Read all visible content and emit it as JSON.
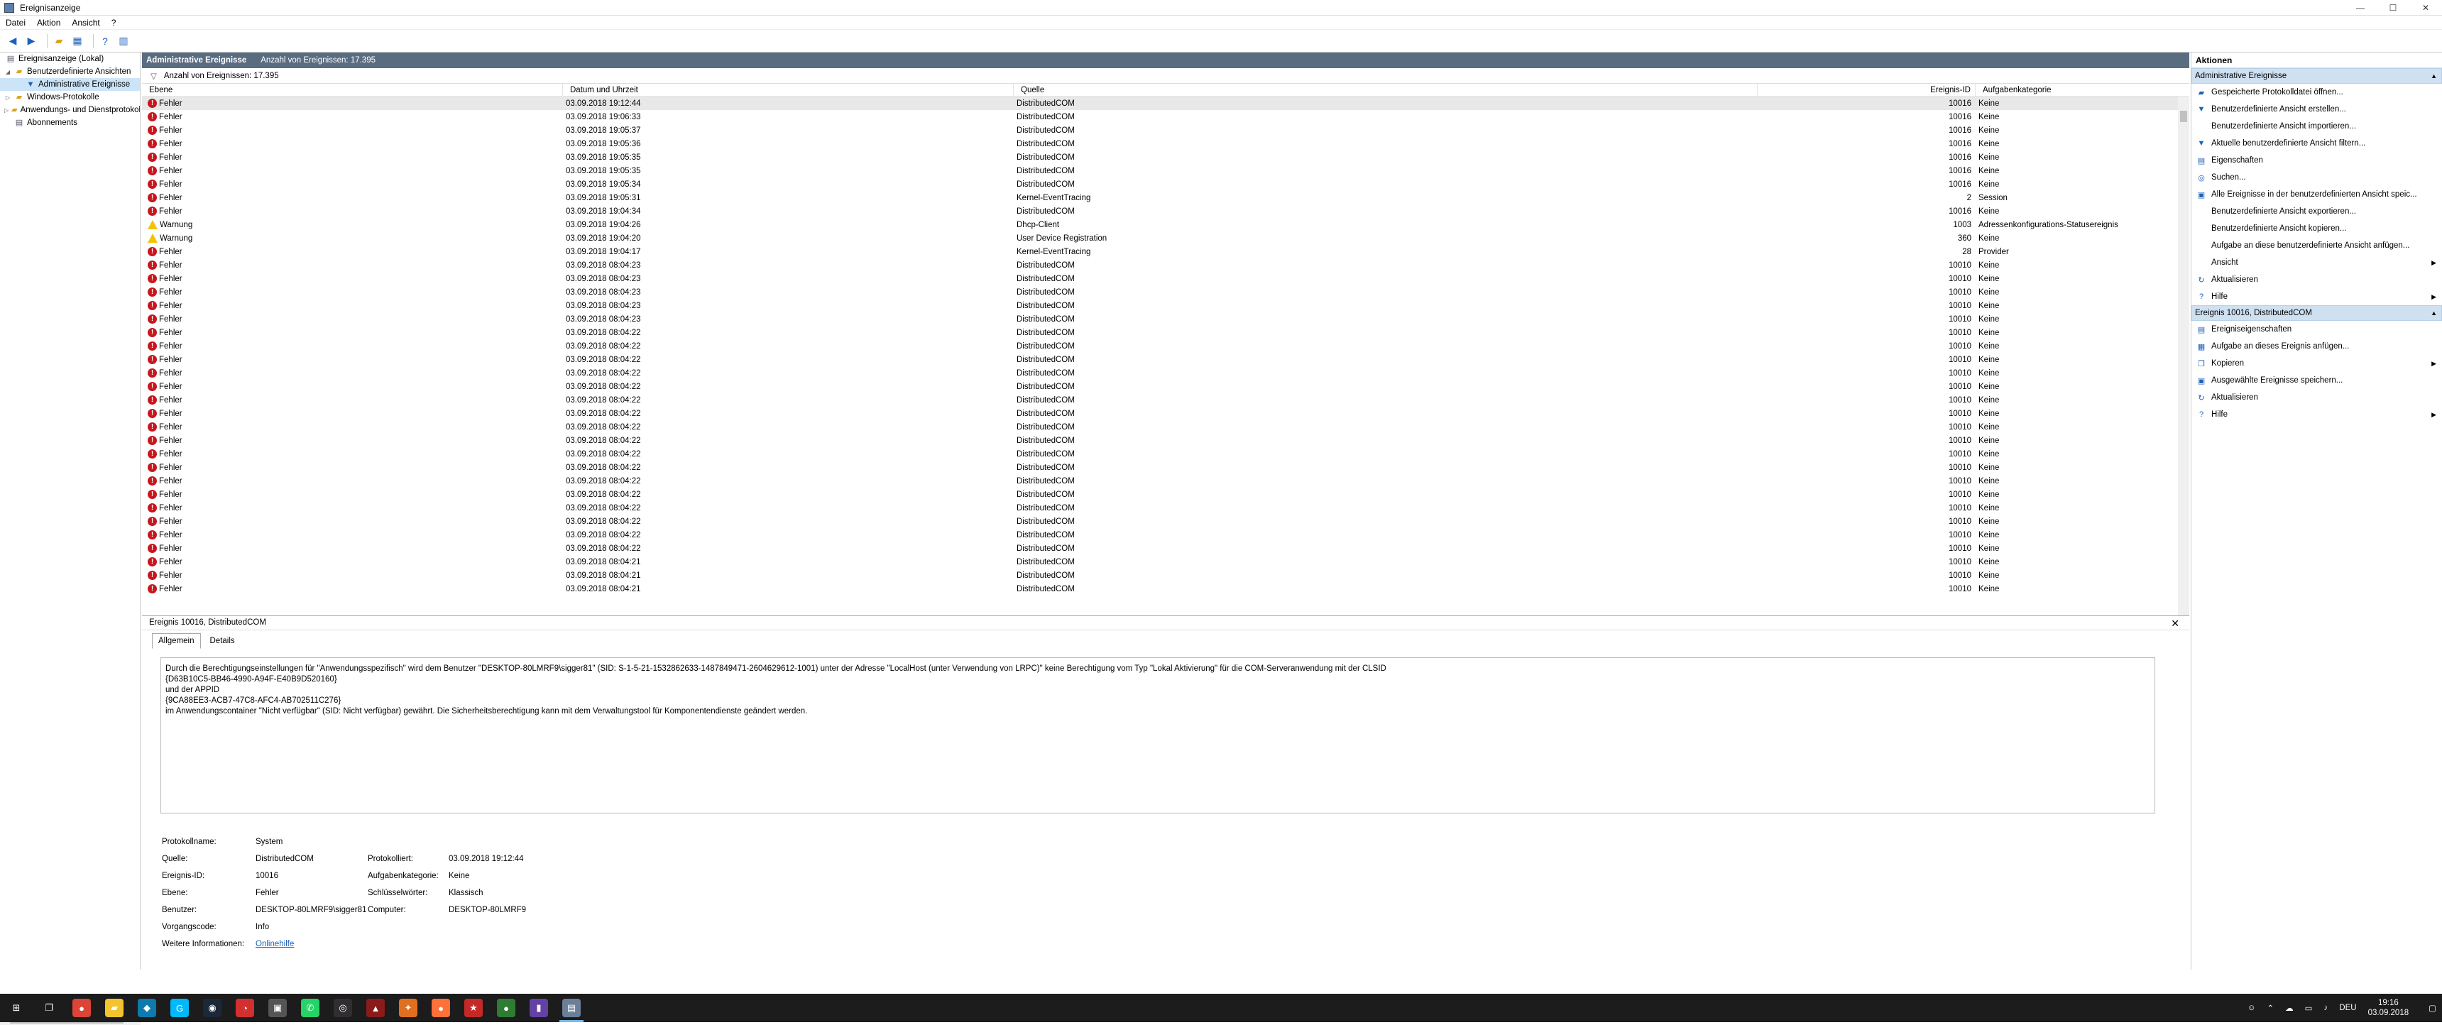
{
  "window": {
    "title": "Ereignisanzeige",
    "minimize": "—",
    "maximize": "☐",
    "close": "✕"
  },
  "menu": [
    "Datei",
    "Aktion",
    "Ansicht",
    "?"
  ],
  "tree": {
    "root": "Ereignisanzeige (Lokal)",
    "custom_views": "Benutzerdefinierte Ansichten",
    "admin_events": "Administrative Ereignisse",
    "windows_logs": "Windows-Protokolle",
    "app_logs": "Anwendungs- und Dienstprotokolle",
    "subscriptions": "Abonnements"
  },
  "header": {
    "title": "Administrative Ereignisse",
    "count": "Anzahl von Ereignissen: 17.395"
  },
  "filter": {
    "text": "Anzahl von Ereignissen: 17.395"
  },
  "columns": [
    "Ebene",
    "Datum und Uhrzeit",
    "Quelle",
    "Ereignis-ID",
    "Aufgabenkategorie"
  ],
  "events": [
    {
      "level": "Fehler",
      "type": "error",
      "date": "03.09.2018 19:12:44",
      "source": "DistributedCOM",
      "id": "10016",
      "category": "Keine"
    },
    {
      "level": "Fehler",
      "type": "error",
      "date": "03.09.2018 19:06:33",
      "source": "DistributedCOM",
      "id": "10016",
      "category": "Keine"
    },
    {
      "level": "Fehler",
      "type": "error",
      "date": "03.09.2018 19:05:37",
      "source": "DistributedCOM",
      "id": "10016",
      "category": "Keine"
    },
    {
      "level": "Fehler",
      "type": "error",
      "date": "03.09.2018 19:05:36",
      "source": "DistributedCOM",
      "id": "10016",
      "category": "Keine"
    },
    {
      "level": "Fehler",
      "type": "error",
      "date": "03.09.2018 19:05:35",
      "source": "DistributedCOM",
      "id": "10016",
      "category": "Keine"
    },
    {
      "level": "Fehler",
      "type": "error",
      "date": "03.09.2018 19:05:35",
      "source": "DistributedCOM",
      "id": "10016",
      "category": "Keine"
    },
    {
      "level": "Fehler",
      "type": "error",
      "date": "03.09.2018 19:05:34",
      "source": "DistributedCOM",
      "id": "10016",
      "category": "Keine"
    },
    {
      "level": "Fehler",
      "type": "error",
      "date": "03.09.2018 19:05:31",
      "source": "Kernel-EventTracing",
      "id": "2",
      "category": "Session"
    },
    {
      "level": "Fehler",
      "type": "error",
      "date": "03.09.2018 19:04:34",
      "source": "DistributedCOM",
      "id": "10016",
      "category": "Keine"
    },
    {
      "level": "Warnung",
      "type": "warn",
      "date": "03.09.2018 19:04:26",
      "source": "Dhcp-Client",
      "id": "1003",
      "category": "Adressenkonfigurations-Statusereignis"
    },
    {
      "level": "Warnung",
      "type": "warn",
      "date": "03.09.2018 19:04:20",
      "source": "User Device Registration",
      "id": "360",
      "category": "Keine"
    },
    {
      "level": "Fehler",
      "type": "error",
      "date": "03.09.2018 19:04:17",
      "source": "Kernel-EventTracing",
      "id": "28",
      "category": "Provider"
    },
    {
      "level": "Fehler",
      "type": "error",
      "date": "03.09.2018 08:04:23",
      "source": "DistributedCOM",
      "id": "10010",
      "category": "Keine"
    },
    {
      "level": "Fehler",
      "type": "error",
      "date": "03.09.2018 08:04:23",
      "source": "DistributedCOM",
      "id": "10010",
      "category": "Keine"
    },
    {
      "level": "Fehler",
      "type": "error",
      "date": "03.09.2018 08:04:23",
      "source": "DistributedCOM",
      "id": "10010",
      "category": "Keine"
    },
    {
      "level": "Fehler",
      "type": "error",
      "date": "03.09.2018 08:04:23",
      "source": "DistributedCOM",
      "id": "10010",
      "category": "Keine"
    },
    {
      "level": "Fehler",
      "type": "error",
      "date": "03.09.2018 08:04:23",
      "source": "DistributedCOM",
      "id": "10010",
      "category": "Keine"
    },
    {
      "level": "Fehler",
      "type": "error",
      "date": "03.09.2018 08:04:22",
      "source": "DistributedCOM",
      "id": "10010",
      "category": "Keine"
    },
    {
      "level": "Fehler",
      "type": "error",
      "date": "03.09.2018 08:04:22",
      "source": "DistributedCOM",
      "id": "10010",
      "category": "Keine"
    },
    {
      "level": "Fehler",
      "type": "error",
      "date": "03.09.2018 08:04:22",
      "source": "DistributedCOM",
      "id": "10010",
      "category": "Keine"
    },
    {
      "level": "Fehler",
      "type": "error",
      "date": "03.09.2018 08:04:22",
      "source": "DistributedCOM",
      "id": "10010",
      "category": "Keine"
    },
    {
      "level": "Fehler",
      "type": "error",
      "date": "03.09.2018 08:04:22",
      "source": "DistributedCOM",
      "id": "10010",
      "category": "Keine"
    },
    {
      "level": "Fehler",
      "type": "error",
      "date": "03.09.2018 08:04:22",
      "source": "DistributedCOM",
      "id": "10010",
      "category": "Keine"
    },
    {
      "level": "Fehler",
      "type": "error",
      "date": "03.09.2018 08:04:22",
      "source": "DistributedCOM",
      "id": "10010",
      "category": "Keine"
    },
    {
      "level": "Fehler",
      "type": "error",
      "date": "03.09.2018 08:04:22",
      "source": "DistributedCOM",
      "id": "10010",
      "category": "Keine"
    },
    {
      "level": "Fehler",
      "type": "error",
      "date": "03.09.2018 08:04:22",
      "source": "DistributedCOM",
      "id": "10010",
      "category": "Keine"
    },
    {
      "level": "Fehler",
      "type": "error",
      "date": "03.09.2018 08:04:22",
      "source": "DistributedCOM",
      "id": "10010",
      "category": "Keine"
    },
    {
      "level": "Fehler",
      "type": "error",
      "date": "03.09.2018 08:04:22",
      "source": "DistributedCOM",
      "id": "10010",
      "category": "Keine"
    },
    {
      "level": "Fehler",
      "type": "error",
      "date": "03.09.2018 08:04:22",
      "source": "DistributedCOM",
      "id": "10010",
      "category": "Keine"
    },
    {
      "level": "Fehler",
      "type": "error",
      "date": "03.09.2018 08:04:22",
      "source": "DistributedCOM",
      "id": "10010",
      "category": "Keine"
    },
    {
      "level": "Fehler",
      "type": "error",
      "date": "03.09.2018 08:04:22",
      "source": "DistributedCOM",
      "id": "10010",
      "category": "Keine"
    },
    {
      "level": "Fehler",
      "type": "error",
      "date": "03.09.2018 08:04:22",
      "source": "DistributedCOM",
      "id": "10010",
      "category": "Keine"
    },
    {
      "level": "Fehler",
      "type": "error",
      "date": "03.09.2018 08:04:22",
      "source": "DistributedCOM",
      "id": "10010",
      "category": "Keine"
    },
    {
      "level": "Fehler",
      "type": "error",
      "date": "03.09.2018 08:04:22",
      "source": "DistributedCOM",
      "id": "10010",
      "category": "Keine"
    },
    {
      "level": "Fehler",
      "type": "error",
      "date": "03.09.2018 08:04:21",
      "source": "DistributedCOM",
      "id": "10010",
      "category": "Keine"
    },
    {
      "level": "Fehler",
      "type": "error",
      "date": "03.09.2018 08:04:21",
      "source": "DistributedCOM",
      "id": "10010",
      "category": "Keine"
    },
    {
      "level": "Fehler",
      "type": "error",
      "date": "03.09.2018 08:04:21",
      "source": "DistributedCOM",
      "id": "10010",
      "category": "Keine"
    }
  ],
  "detail": {
    "title": "Ereignis 10016, DistributedCOM",
    "tab_general": "Allgemein",
    "tab_details": "Details",
    "message": [
      "Durch die Berechtigungseinstellungen für \"Anwendungsspezifisch\" wird dem Benutzer \"DESKTOP-80LMRF9\\sigger81\" (SID: S-1-5-21-1532862633-1487849471-2604629612-1001) unter der Adresse \"LocalHost (unter Verwendung von LRPC)\" keine Berechtigung vom Typ \"Lokal Aktivierung\" für die COM-Serveranwendung mit der CLSID",
      "{D63B10C5-BB46-4990-A94F-E40B9D520160}",
      "und der APPID",
      "{9CA88EE3-ACB7-47C8-AFC4-AB702511C276}",
      "im Anwendungscontainer \"Nicht verfügbar\" (SID: Nicht verfügbar) gewährt. Die Sicherheitsberechtigung kann mit dem Verwaltungstool für Komponentendienste geändert werden."
    ],
    "props": {
      "log_label": "Protokollname:",
      "log": "System",
      "source_label": "Quelle:",
      "source": "DistributedCOM",
      "logged_label": "Protokolliert:",
      "logged": "03.09.2018 19:12:44",
      "id_label": "Ereignis-ID:",
      "id": "10016",
      "task_label": "Aufgabenkategorie:",
      "task": "Keine",
      "level_label": "Ebene:",
      "level": "Fehler",
      "keywords_label": "Schlüsselwörter:",
      "keywords": "Klassisch",
      "user_label": "Benutzer:",
      "user": "DESKTOP-80LMRF9\\sigger81",
      "computer_label": "Computer:",
      "computer": "DESKTOP-80LMRF9",
      "opcode_label": "Vorgangscode:",
      "opcode": "Info",
      "more_label": "Weitere Informationen:",
      "more": "Onlinehilfe"
    }
  },
  "actions": {
    "title": "Aktionen",
    "section1": "Administrative Ereignisse",
    "items1": [
      {
        "label": "Gespeicherte Protokolldatei öffnen...",
        "icon": "folder-icon"
      },
      {
        "label": "Benutzerdefinierte Ansicht erstellen...",
        "icon": "filter-icon"
      },
      {
        "label": "Benutzerdefinierte Ansicht importieren...",
        "icon": ""
      },
      {
        "label": "Aktuelle benutzerdefinierte Ansicht filtern...",
        "icon": "filter-icon"
      },
      {
        "label": "Eigenschaften",
        "icon": "properties-icon"
      },
      {
        "label": "Suchen...",
        "icon": "binoculars-icon"
      },
      {
        "label": "Alle Ereignisse in der benutzerdefinierten Ansicht speic...",
        "icon": "save-icon"
      },
      {
        "label": "Benutzerdefinierte Ansicht exportieren...",
        "icon": ""
      },
      {
        "label": "Benutzerdefinierte Ansicht kopieren...",
        "icon": ""
      },
      {
        "label": "Aufgabe an diese benutzerdefinierte Ansicht anfügen...",
        "icon": ""
      },
      {
        "label": "Ansicht",
        "icon": "",
        "sub": true
      },
      {
        "label": "Aktualisieren",
        "icon": "refresh-icon"
      },
      {
        "label": "Hilfe",
        "icon": "help-icon",
        "sub": true
      }
    ],
    "section2": "Ereignis 10016, DistributedCOM",
    "items2": [
      {
        "label": "Ereigniseigenschaften",
        "icon": "properties-icon"
      },
      {
        "label": "Aufgabe an dieses Ereignis anfügen...",
        "icon": "task-icon"
      },
      {
        "label": "Kopieren",
        "icon": "copy-icon",
        "sub": true
      },
      {
        "label": "Ausgewählte Ereignisse speichern...",
        "icon": "save-icon"
      },
      {
        "label": "Aktualisieren",
        "icon": "refresh-icon"
      },
      {
        "label": "Hilfe",
        "icon": "help-icon",
        "sub": true
      }
    ]
  },
  "taskbar": {
    "apps": [
      {
        "name": "start-icon",
        "color": "#1c1c1c",
        "glyph": "⊞"
      },
      {
        "name": "task-view-icon",
        "color": "#1c1c1c",
        "glyph": "❐"
      },
      {
        "name": "chrome-icon",
        "color": "#db4437",
        "glyph": "●"
      },
      {
        "name": "explorer-icon",
        "color": "#f4c430",
        "glyph": "▰"
      },
      {
        "name": "app-icon",
        "color": "#0e7aad",
        "glyph": "◆"
      },
      {
        "name": "logitech-icon",
        "color": "#00b8fc",
        "glyph": "G"
      },
      {
        "name": "steam-icon",
        "color": "#1b2838",
        "glyph": "◉"
      },
      {
        "name": "speedometer-icon",
        "color": "#d32f2f",
        "glyph": "◔"
      },
      {
        "name": "gamepad-icon",
        "color": "#555",
        "glyph": "▣"
      },
      {
        "name": "whatsapp-icon",
        "color": "#25d366",
        "glyph": "✆"
      },
      {
        "name": "obs-icon",
        "color": "#302e31",
        "glyph": "◎"
      },
      {
        "name": "app-red-icon",
        "color": "#8b1a1a",
        "glyph": "▲"
      },
      {
        "name": "tools-icon",
        "color": "#e07020",
        "glyph": "✦"
      },
      {
        "name": "firefox-icon",
        "color": "#ff7139",
        "glyph": "●"
      },
      {
        "name": "bookmark-icon",
        "color": "#c62828",
        "glyph": "★"
      },
      {
        "name": "greenshot-icon",
        "color": "#2e7d32",
        "glyph": "●"
      },
      {
        "name": "twitch-icon",
        "color": "#6441a5",
        "glyph": "▮"
      },
      {
        "name": "eventviewer-icon",
        "color": "#6b7f99",
        "glyph": "▤"
      }
    ],
    "tray_lang": "DEU",
    "time": "19:16",
    "date": "03.09.2018"
  }
}
